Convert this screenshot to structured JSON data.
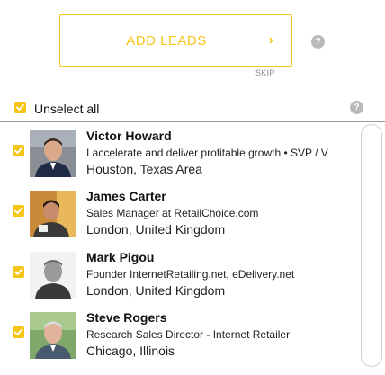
{
  "header": {
    "add_leads_label": "ADD LEADS",
    "chevron_glyph": "›",
    "skip_label": "SKIP",
    "help_glyph": "?"
  },
  "selection": {
    "label": "Unselect all",
    "checked": true
  },
  "leads": [
    {
      "name": "Victor Howard",
      "title": "I accelerate and deliver profitable growth • SVP / V",
      "location": "Houston, Texas Area",
      "checked": true
    },
    {
      "name": "James Carter",
      "title": "Sales Manager at RetailChoice.com",
      "location": "London, United Kingdom",
      "checked": true
    },
    {
      "name": "Mark Pigou",
      "title": "Founder InternetRetailing.net, eDelivery.net",
      "location": "London, United Kingdom",
      "checked": true
    },
    {
      "name": "Steve Rogers",
      "title": "Research Sales Director - Internet Retailer",
      "location": "Chicago, Illinois",
      "checked": true
    }
  ],
  "colors": {
    "accent": "#f5c518",
    "help_icon": "#b9b9b9",
    "divider": "#9a9a9a"
  },
  "icons": {
    "checkbox": "checkmark-icon",
    "help": "help-icon",
    "next": "chevron-right-icon"
  }
}
